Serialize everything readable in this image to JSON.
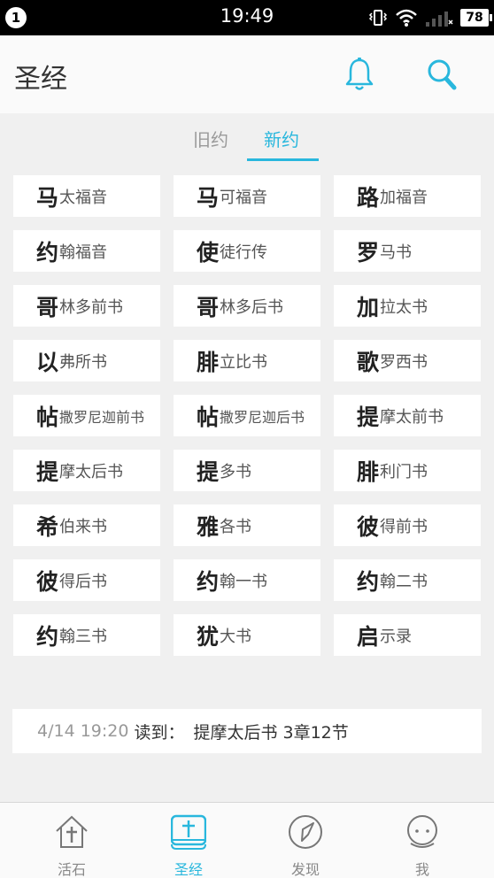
{
  "status_bar": {
    "notification_count": "1",
    "time": "19:49",
    "battery": "78",
    "icons": [
      "vibrate-icon",
      "wifi-icon",
      "signal-icon",
      "battery-icon"
    ]
  },
  "header": {
    "title": "圣经",
    "icons": [
      "bell-icon",
      "search-icon"
    ]
  },
  "tabs": [
    {
      "label": "旧约",
      "active": false
    },
    {
      "label": "新约",
      "active": true
    }
  ],
  "books": [
    {
      "first": "马",
      "rest": "太福音"
    },
    {
      "first": "马",
      "rest": "可福音"
    },
    {
      "first": "路",
      "rest": "加福音"
    },
    {
      "first": "约",
      "rest": "翰福音"
    },
    {
      "first": "使",
      "rest": "徒行传"
    },
    {
      "first": "罗",
      "rest": "马书"
    },
    {
      "first": "哥",
      "rest": "林多前书"
    },
    {
      "first": "哥",
      "rest": "林多后书"
    },
    {
      "first": "加",
      "rest": "拉太书"
    },
    {
      "first": "以",
      "rest": "弗所书"
    },
    {
      "first": "腓",
      "rest": "立比书"
    },
    {
      "first": "歌",
      "rest": "罗西书"
    },
    {
      "first": "帖",
      "rest": "撒罗尼迦前书"
    },
    {
      "first": "帖",
      "rest": "撒罗尼迦后书"
    },
    {
      "first": "提",
      "rest": "摩太前书"
    },
    {
      "first": "提",
      "rest": "摩太后书"
    },
    {
      "first": "提",
      "rest": "多书"
    },
    {
      "first": "腓",
      "rest": "利门书"
    },
    {
      "first": "希",
      "rest": "伯来书"
    },
    {
      "first": "雅",
      "rest": "各书"
    },
    {
      "first": "彼",
      "rest": "得前书"
    },
    {
      "first": "彼",
      "rest": "得后书"
    },
    {
      "first": "约",
      "rest": "翰一书"
    },
    {
      "first": "约",
      "rest": "翰二书"
    },
    {
      "first": "约",
      "rest": "翰三书"
    },
    {
      "first": "犹",
      "rest": "大书"
    },
    {
      "first": "启",
      "rest": "示录"
    }
  ],
  "last_read": {
    "time": "4/14 19:20",
    "label": "读到：",
    "book": "提摩太后书",
    "chapter": "3章12节"
  },
  "bottom_nav": [
    {
      "label": "活石",
      "icon": "house-cross-icon",
      "active": false
    },
    {
      "label": "圣经",
      "icon": "bible-book-icon",
      "active": true
    },
    {
      "label": "发现",
      "icon": "compass-icon",
      "active": false
    },
    {
      "label": "我",
      "icon": "user-face-icon",
      "active": false
    }
  ],
  "colors": {
    "accent": "#29b7dd",
    "background": "#f0f0f0",
    "card": "#ffffff",
    "header": "#fafafa"
  }
}
